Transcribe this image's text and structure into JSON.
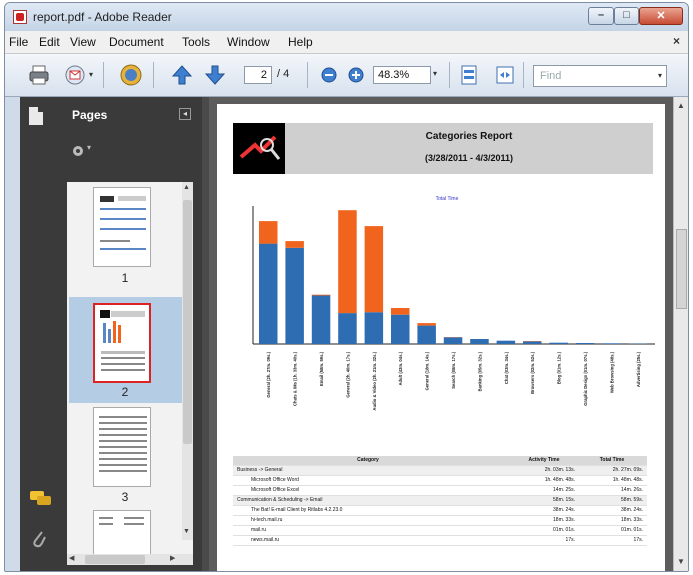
{
  "window": {
    "title": "report.pdf - Adobe Reader"
  },
  "menu": [
    "File",
    "Edit",
    "View",
    "Document",
    "Tools",
    "Window",
    "Help"
  ],
  "menu_close": "×",
  "toolbar": {
    "page_current": "2",
    "page_total": "/ 4",
    "zoom": "48.3%",
    "find_placeholder": "Find",
    "icons": [
      "print-icon",
      "email-icon",
      "collaborate-icon",
      "previous-page-icon",
      "next-page-icon",
      "zoom-out-icon",
      "zoom-in-icon",
      "fit-page-icon",
      "fit-width-icon"
    ]
  },
  "panel": {
    "label": "Pages",
    "thumbnails": [
      {
        "number": "1"
      },
      {
        "number": "2",
        "selected": true
      },
      {
        "number": "3"
      },
      {
        "number": ""
      }
    ]
  },
  "report": {
    "title": "Categories Report",
    "range": "(3/28/2011 - 4/3/2011)",
    "chart_legend": "Total Time",
    "table": {
      "headers": [
        "Category",
        "Activity Time",
        "Total Time"
      ],
      "rows": [
        {
          "category": "Business -> General",
          "activity": "2h. 03m. 13s.",
          "total": "2h. 27m. 09s.",
          "group": true
        },
        {
          "category": "Microsoft Office Word",
          "activity": "1h. 48m. 48s.",
          "total": "1h. 48m. 48s.",
          "group": false
        },
        {
          "category": "Microsoft Office Excel",
          "activity": "14m. 25s.",
          "total": "14m. 26s.",
          "group": false
        },
        {
          "category": "Communication & Scheduling -> Email",
          "activity": "58m. 15s.",
          "total": "58m. 59s.",
          "group": true
        },
        {
          "category": "The Bat! E-mail Client by Ritlabs 4.2.23.0",
          "activity": "38m. 24s.",
          "total": "38m. 24s.",
          "group": false
        },
        {
          "category": "hi-tech.mail.ru",
          "activity": "18m. 33s.",
          "total": "18m. 33s.",
          "group": false
        },
        {
          "category": "mail.ru",
          "activity": "01m. 01s.",
          "total": "01m. 01s.",
          "group": false
        },
        {
          "category": "news.mail.ru",
          "activity": "17s.",
          "total": "17s.",
          "group": false
        }
      ]
    }
  },
  "chart_data": {
    "type": "bar",
    "title": "Total Time",
    "categories": [
      "General (2h. 27m. 09s.)",
      "Chats & IMs (1h. 33m. 40s.)",
      "Email (58m. 59s.)",
      "General (2h. 40m. 17s.)",
      "Audio & Video (2h. 21m. 32s.)",
      "Adult (43m. 04s.)",
      "General (18m. 14s.)",
      "Search (08m. 17s.)",
      "Banking (05m. 32s.)",
      "Chat (03m. 34s.)",
      "Browsers (02m. 52s.)",
      "Blog (01m. 12s.)",
      "Graphic Design (01m. 07s.)",
      "Web Browsing (48s.)",
      "Advertising (25s.)"
    ],
    "series": [
      {
        "values": [
          120,
          115,
          58,
          37,
          38,
          35,
          22,
          8,
          6,
          4,
          3,
          1.5,
          1.2,
          0.8,
          0.4
        ],
        "color": "#2f6db3"
      },
      {
        "values": [
          27,
          8,
          1,
          123,
          103,
          8,
          3,
          0.3,
          0,
          0,
          0.5,
          0,
          0,
          0,
          0
        ],
        "color": "#f0641e"
      }
    ],
    "stacked": true,
    "ylim": [
      0,
      165
    ],
    "grid": false
  }
}
